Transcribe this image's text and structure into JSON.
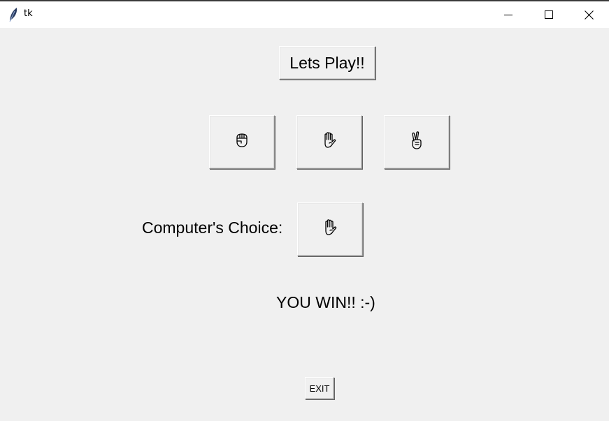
{
  "window": {
    "title": "tk",
    "controls": {
      "minimize": "minimize-icon",
      "maximize": "maximize-icon",
      "close": "close-icon"
    }
  },
  "main": {
    "play_label": "Lets Play!!",
    "choices": [
      {
        "name": "rock",
        "icon": "fist-hand-icon"
      },
      {
        "name": "paper",
        "icon": "open-hand-icon"
      },
      {
        "name": "scissors",
        "icon": "victory-hand-icon"
      }
    ],
    "computer_label": "Computer's Choice:",
    "computer_choice_icon": "open-hand-icon",
    "result": "YOU WIN!! :-)",
    "exit_label": "EXIT"
  }
}
